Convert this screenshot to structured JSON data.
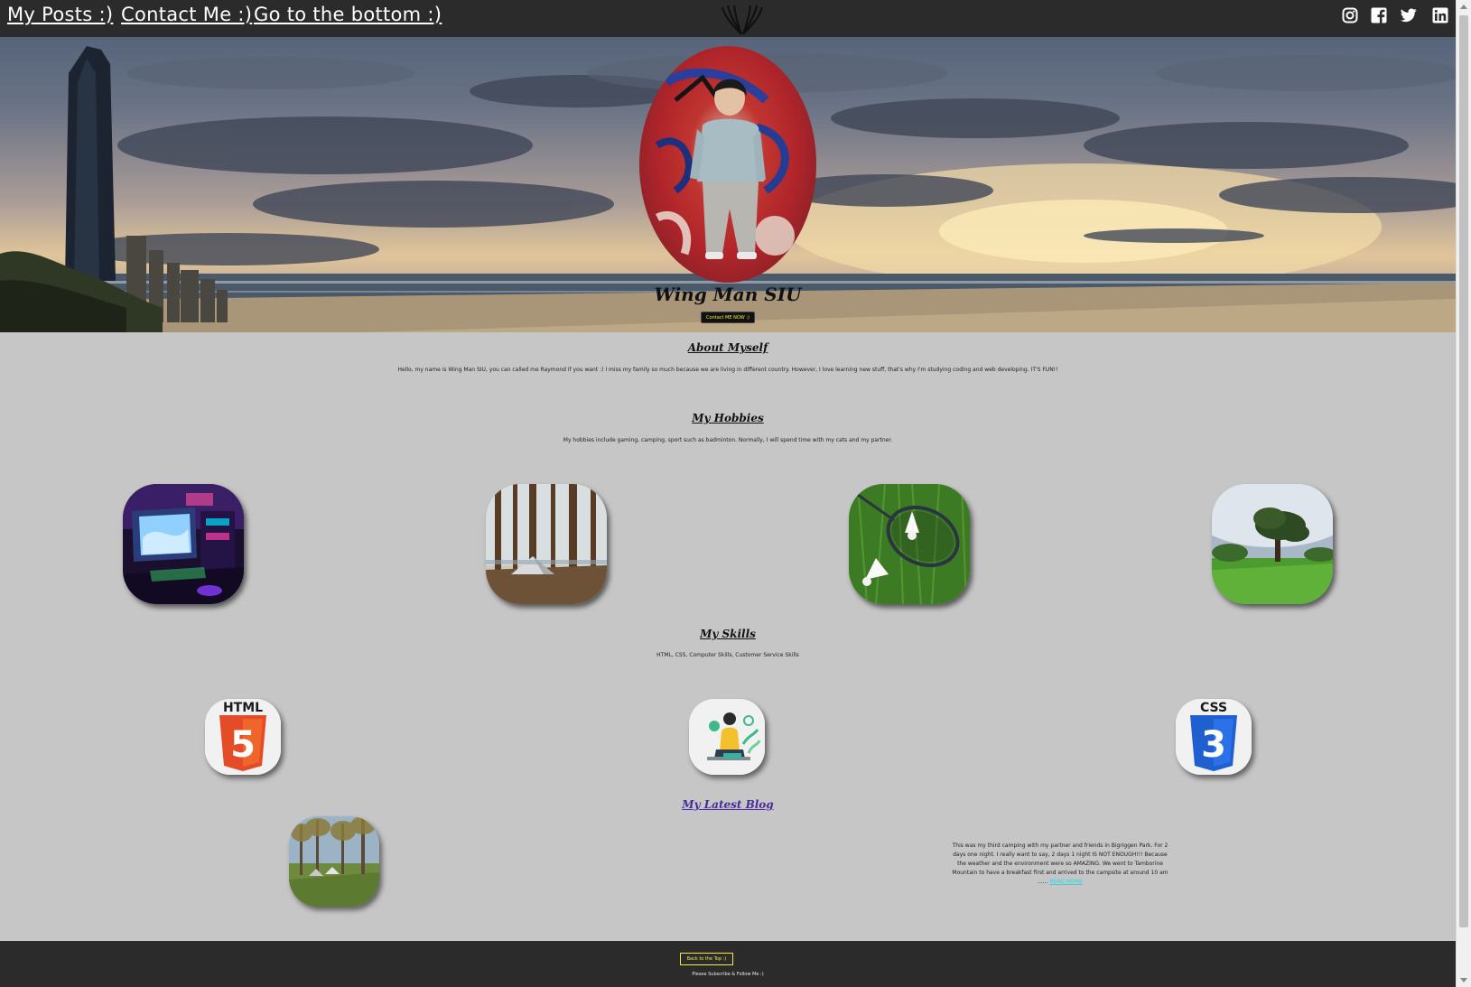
{
  "nav": {
    "links": [
      "My Posts :)",
      "Contact Me :)",
      "Go to the bottom :)"
    ],
    "logo_icon": "wings-logo-icon",
    "social_icons": [
      "instagram-icon",
      "facebook-icon",
      "twitter-icon",
      "linkedin-icon"
    ]
  },
  "hero": {
    "name": "Wing Man SIU",
    "button": "Contact ME NOW :)"
  },
  "about": {
    "title": "About Myself",
    "text": "Hello, my name is Wing Man SIU, you can called me Raymond if you want :) I miss my family so much because we are living in different country. However, I love learning new stuff, that's why I'm studying coding and web developing. IT'S FUN!!"
  },
  "hobbies": {
    "title": "My Hobbies",
    "text": "My hobbies include gaming, camping, sport such as badminton. Normally, I will spend time with my cats and my partner.",
    "images": [
      "gaming-setup-image",
      "camping-tent-image",
      "badminton-image",
      "park-tree-image"
    ]
  },
  "skills": {
    "title": "My Skills",
    "text": "HTML, CSS, Computer Skills, Customer Service Skills",
    "html_label": "HTML",
    "html_number": "5",
    "css_label": "CSS",
    "css_number": "3"
  },
  "blog": {
    "title": "My Latest Blog",
    "text": "This was my third camping with my partner and friends in Bigriggen Park. For 2 days one night. I really want to say, 2 days 1 night IS NOT ENOUGH!!! Because the weather and the environment were so AMAZING. We went to Tamborine Mountain to have a breakfast first and arrived to the campsite at around 10 am ......",
    "link": "READ MORE"
  },
  "footer": {
    "back_button": "Back to the Top :)",
    "note": "Please Subscribe & Follow Me :)"
  },
  "colors": {
    "nav_bg": "#2b2b2b",
    "page_bg": "#c6c6c6",
    "accent_yellow": "#f3ea3f",
    "blog_link": "#27d9e4",
    "blog_title": "#4a2aa0"
  }
}
